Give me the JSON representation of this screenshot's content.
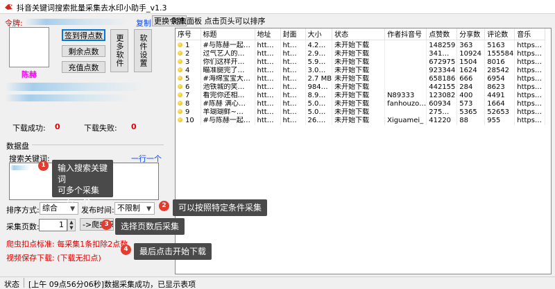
{
  "window": {
    "title": "抖音关键词搜索批量采集去水印小助手_v1.3",
    "icon": "app-bird-icon"
  },
  "account": {
    "token_label": "令牌:",
    "copy_label": "复制",
    "change_token_label": "更换令牌",
    "signin_label": "签到得点数",
    "remaining_label": "剩余点数",
    "recharge_label": "充值点数",
    "more_software_label": "更多软件",
    "settings_label": "软件设置",
    "username": "陈赫"
  },
  "stats": {
    "success_label": "下载成功:",
    "success_value": "0",
    "fail_label": "下载失败:",
    "fail_value": "0"
  },
  "data_panel": {
    "title": "数据盘",
    "keyword_label": "搜索关键词:",
    "one_per_line_label": "一行一个",
    "keyword_value": "",
    "sort_label": "排序方式:",
    "sort_value": "综合",
    "time_label": "发布时间:",
    "time_value": "不限制",
    "pages_label": "采集页数:",
    "pages_value": "1",
    "crawl_label": "->爬虫采集",
    "fee_note": "爬虫扣点标准: 每采集1条扣除2点数",
    "video_save_label": "视频保存下载: (下载无扣点)"
  },
  "tooltips": [
    {
      "num": "1",
      "text": "输入搜索关键词\n可多个采集\n一行一个"
    },
    {
      "num": "2",
      "text": "可以按照特定条件采集"
    },
    {
      "num": "3",
      "text": "选择页数后采集"
    },
    {
      "num": "4",
      "text": "最后点击开始下载"
    }
  ],
  "table": {
    "panel_title": "爬虫面板 点击页头可以排序",
    "columns": [
      "序号",
      "标题",
      "地址",
      "封面",
      "大小",
      "状态",
      "作者抖音号",
      "点赞数",
      "分享数",
      "评论数",
      "音乐"
    ],
    "rows": [
      [
        "1",
        "#与陈赫一起…",
        "htt…",
        "ht…",
        "4.2…",
        "未开始下载",
        "",
        "148259",
        "363",
        "5163",
        "https…"
      ],
      [
        "2",
        "过气艺人的…",
        "htt…",
        "ht…",
        "2.9…",
        "未开始下载",
        "",
        "341…",
        "10924",
        "155584",
        "https…"
      ],
      [
        "3",
        "你们这样开…",
        "htt…",
        "ht…",
        "5.9…",
        "未开始下载",
        "",
        "672975",
        "1504",
        "8016",
        "https…"
      ],
      [
        "4",
        "瞄准腿完了…",
        "htt…",
        "ht…",
        "3.0…",
        "未开始下载",
        "",
        "923344",
        "1624",
        "28542",
        "https…"
      ],
      [
        "5",
        "#海绵宝宝大…",
        "htt…",
        "ht…",
        "2.7 MB",
        "未开始下载",
        "",
        "658186",
        "666",
        "6954",
        "https…"
      ],
      [
        "6",
        "池铁城的笑…",
        "htt…",
        "ht…",
        "984…",
        "未开始下载",
        "",
        "442155",
        "284",
        "8623",
        "https…"
      ],
      [
        "7",
        "看完你还相…",
        "htt…",
        "ht…",
        "8.9…",
        "未开始下载",
        "N89333",
        "123082",
        "400",
        "4491",
        "https…"
      ],
      [
        "8",
        "#陈赫 满心…",
        "htt…",
        "ht…",
        "5.0…",
        "未开始下载",
        "fanhouzo…",
        "60934",
        "573",
        "1664",
        "https…"
      ],
      [
        "9",
        "羊瑚瑚鲜~…",
        "htt…",
        "ht…",
        "5.0…",
        "未开始下载",
        "",
        "275…",
        "5365",
        "52653",
        "https…"
      ],
      [
        "10",
        "#与陈赫一起…",
        "htt…",
        "ht…",
        "26.…",
        "未开始下载",
        "Xiguamei_",
        "41220",
        "88",
        "955",
        "https…"
      ]
    ]
  },
  "status": {
    "label": "状态",
    "message": "[上午 09点56分06秒]数据采集成功，已显示表项"
  }
}
